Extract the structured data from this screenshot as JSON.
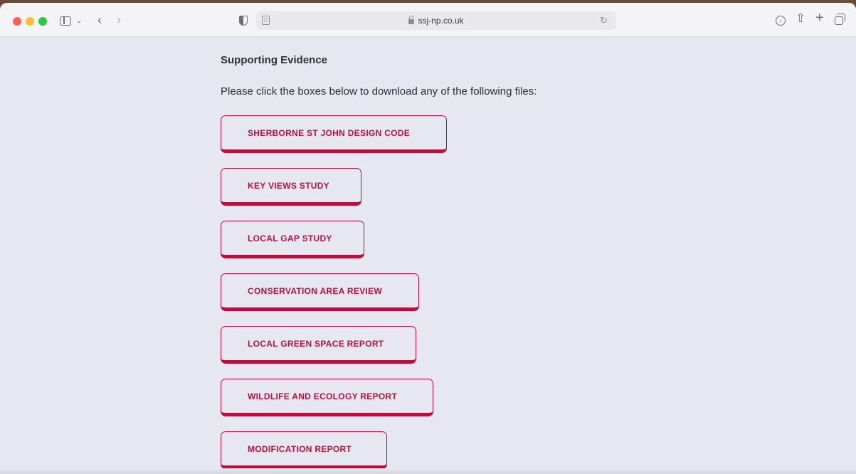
{
  "browser": {
    "url": "ssj-np.co.uk"
  },
  "page": {
    "heading": "Supporting Evidence",
    "intro": "Please click the boxes below to download any of the following files:",
    "buttons": [
      "SHERBORNE ST JOHN DESIGN CODE",
      "KEY VIEWS STUDY",
      "LOCAL GAP STUDY",
      "CONSERVATION AREA REVIEW",
      "LOCAL GREEN SPACE REPORT",
      "WILDLIFE AND ECOLOGY REPORT",
      "MODIFICATION REPORT"
    ]
  },
  "colors": {
    "accent": "#b3123f",
    "background": "#e6e7f1"
  }
}
